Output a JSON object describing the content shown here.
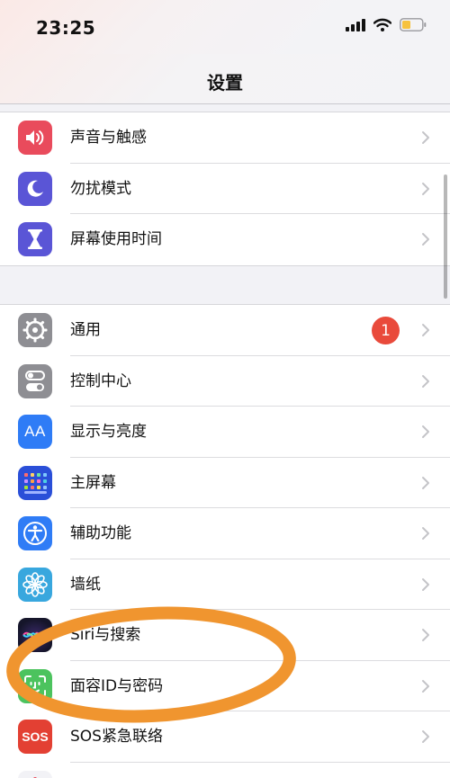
{
  "status_bar": {
    "time": "23:25",
    "icons": [
      "cellular-signal-icon",
      "wifi-icon",
      "battery-icon"
    ]
  },
  "nav": {
    "title": "设置"
  },
  "group1": {
    "items": [
      {
        "label": "声音与触感",
        "icon": "speaker-icon",
        "color": "#e94b5c"
      },
      {
        "label": "勿扰模式",
        "icon": "moon-icon",
        "color": "#5a55d6"
      },
      {
        "label": "屏幕使用时间",
        "icon": "hourglass-icon",
        "color": "#5a55d6"
      }
    ]
  },
  "group2": {
    "items": [
      {
        "label": "通用",
        "icon": "gear-icon",
        "color": "#8e8e93",
        "badge": "1"
      },
      {
        "label": "控制中心",
        "icon": "toggle-icon",
        "color": "#8e8e93"
      },
      {
        "label": "显示与亮度",
        "icon": "text-size-icon",
        "color": "#2f7cf6",
        "icon_text": "AA"
      },
      {
        "label": "主屏幕",
        "icon": "home-screen-grid-icon",
        "color": "#2a4fd8"
      },
      {
        "label": "辅助功能",
        "icon": "accessibility-icon",
        "color": "#2f7cf6"
      },
      {
        "label": "墙纸",
        "icon": "flower-icon",
        "color": "#38a7de"
      },
      {
        "label": "Siri与搜索",
        "icon": "siri-icon",
        "color": "#1a1a2e"
      },
      {
        "label": "面容ID与密码",
        "icon": "face-id-icon",
        "color": "#4cc35e"
      },
      {
        "label": "SOS紧急联络",
        "icon": "sos-icon",
        "color": "#e34033",
        "icon_text": "SOS"
      }
    ]
  },
  "colors": {
    "annotation_circle": "#f0952f",
    "badge": "#e94a3b",
    "background": "#f2f2f6"
  }
}
